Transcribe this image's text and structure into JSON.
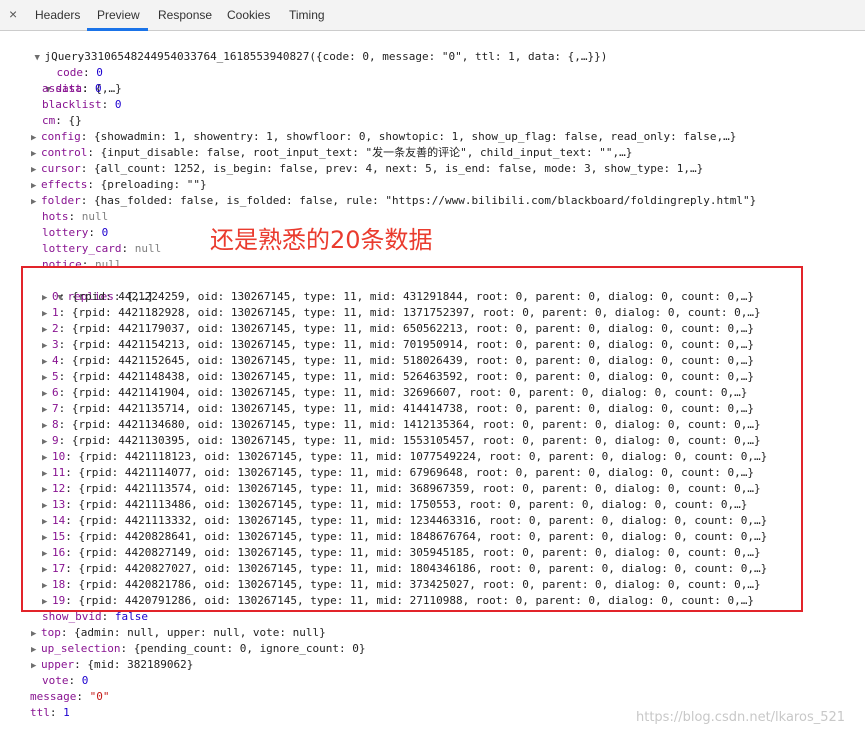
{
  "tabs": {
    "close_glyph": "×",
    "items": [
      "Headers",
      "Preview",
      "Response",
      "Cookies",
      "Timing"
    ],
    "active": "Preview"
  },
  "root_line": "jQuery33106548244954033764_1618553940827({code: 0, message: \"0\", ttl: 1, data: {,…}})",
  "top": {
    "code": {
      "key": "code",
      "value": "0"
    },
    "data": {
      "key": "data",
      "value": "{,…}"
    }
  },
  "data_fields": [
    {
      "key": "assist",
      "value": "0",
      "kind": "num",
      "expandable": false
    },
    {
      "key": "blacklist",
      "value": "0",
      "kind": "num",
      "expandable": false
    },
    {
      "key": "cm",
      "value": "{}",
      "kind": "plain",
      "expandable": false
    },
    {
      "key": "config",
      "value": "{showadmin: 1, showentry: 1, showfloor: 0, showtopic: 1, show_up_flag: false, read_only: false,…}",
      "kind": "plain",
      "expandable": true
    },
    {
      "key": "control",
      "value": "{input_disable: false, root_input_text: \"发一条友善的评论\", child_input_text: \"\",…}",
      "kind": "plain",
      "expandable": true
    },
    {
      "key": "cursor",
      "value": "{all_count: 1252, is_begin: false, prev: 4, next: 5, is_end: false, mode: 3, show_type: 1,…}",
      "kind": "plain",
      "expandable": true
    },
    {
      "key": "effects",
      "value": "{preloading: \"\"}",
      "kind": "plain",
      "expandable": true
    },
    {
      "key": "folder",
      "value": "{has_folded: false, is_folded: false, rule: \"https://www.bilibili.com/blackboard/foldingreply.html\"}",
      "kind": "plain",
      "expandable": true
    },
    {
      "key": "hots",
      "value": "null",
      "kind": "nul",
      "expandable": false
    },
    {
      "key": "lottery",
      "value": "0",
      "kind": "num",
      "expandable": false
    },
    {
      "key": "lottery_card",
      "value": "null",
      "kind": "nul",
      "expandable": false
    },
    {
      "key": "notice",
      "value": "null",
      "kind": "nul",
      "expandable": false
    }
  ],
  "replies": {
    "key": "replies",
    "value": "[,…]",
    "items": [
      {
        "i": "0",
        "text": "{rpid: 4421224259, oid: 130267145, type: 11, mid: 431291844, root: 0, parent: 0, dialog: 0, count: 0,…}"
      },
      {
        "i": "1",
        "text": "{rpid: 4421182928, oid: 130267145, type: 11, mid: 1371752397, root: 0, parent: 0, dialog: 0, count: 0,…}"
      },
      {
        "i": "2",
        "text": "{rpid: 4421179037, oid: 130267145, type: 11, mid: 650562213, root: 0, parent: 0, dialog: 0, count: 0,…}"
      },
      {
        "i": "3",
        "text": "{rpid: 4421154213, oid: 130267145, type: 11, mid: 701950914, root: 0, parent: 0, dialog: 0, count: 0,…}"
      },
      {
        "i": "4",
        "text": "{rpid: 4421152645, oid: 130267145, type: 11, mid: 518026439, root: 0, parent: 0, dialog: 0, count: 0,…}"
      },
      {
        "i": "5",
        "text": "{rpid: 4421148438, oid: 130267145, type: 11, mid: 526463592, root: 0, parent: 0, dialog: 0, count: 0,…}"
      },
      {
        "i": "6",
        "text": "{rpid: 4421141904, oid: 130267145, type: 11, mid: 32696607, root: 0, parent: 0, dialog: 0, count: 0,…}"
      },
      {
        "i": "7",
        "text": "{rpid: 4421135714, oid: 130267145, type: 11, mid: 414414738, root: 0, parent: 0, dialog: 0, count: 0,…}"
      },
      {
        "i": "8",
        "text": "{rpid: 4421134680, oid: 130267145, type: 11, mid: 1412135364, root: 0, parent: 0, dialog: 0, count: 0,…}"
      },
      {
        "i": "9",
        "text": "{rpid: 4421130395, oid: 130267145, type: 11, mid: 1553105457, root: 0, parent: 0, dialog: 0, count: 0,…}"
      },
      {
        "i": "10",
        "text": "{rpid: 4421118123, oid: 130267145, type: 11, mid: 1077549224, root: 0, parent: 0, dialog: 0, count: 0,…}"
      },
      {
        "i": "11",
        "text": "{rpid: 4421114077, oid: 130267145, type: 11, mid: 67969648, root: 0, parent: 0, dialog: 0, count: 0,…}"
      },
      {
        "i": "12",
        "text": "{rpid: 4421113574, oid: 130267145, type: 11, mid: 368967359, root: 0, parent: 0, dialog: 0, count: 0,…}"
      },
      {
        "i": "13",
        "text": "{rpid: 4421113486, oid: 130267145, type: 11, mid: 1750553, root: 0, parent: 0, dialog: 0, count: 0,…}"
      },
      {
        "i": "14",
        "text": "{rpid: 4421113332, oid: 130267145, type: 11, mid: 1234463316, root: 0, parent: 0, dialog: 0, count: 0,…}"
      },
      {
        "i": "15",
        "text": "{rpid: 4420828641, oid: 130267145, type: 11, mid: 1848676764, root: 0, parent: 0, dialog: 0, count: 0,…}"
      },
      {
        "i": "16",
        "text": "{rpid: 4420827149, oid: 130267145, type: 11, mid: 305945185, root: 0, parent: 0, dialog: 0, count: 0,…}"
      },
      {
        "i": "17",
        "text": "{rpid: 4420827027, oid: 130267145, type: 11, mid: 1804346186, root: 0, parent: 0, dialog: 0, count: 0,…}"
      },
      {
        "i": "18",
        "text": "{rpid: 4420821786, oid: 130267145, type: 11, mid: 373425027, root: 0, parent: 0, dialog: 0, count: 0,…}"
      },
      {
        "i": "19",
        "text": "{rpid: 4420791286, oid: 130267145, type: 11, mid: 27110988, root: 0, parent: 0, dialog: 0, count: 0,…}"
      }
    ]
  },
  "after_fields": [
    {
      "key": "show_bvid",
      "value": "false",
      "kind": "kw",
      "expandable": false
    },
    {
      "key": "top",
      "value": "{admin: null, upper: null, vote: null}",
      "kind": "plain",
      "expandable": true
    },
    {
      "key": "up_selection",
      "value": "{pending_count: 0, ignore_count: 0}",
      "kind": "plain",
      "expandable": true
    },
    {
      "key": "upper",
      "value": "{mid: 382189062}",
      "kind": "plain",
      "expandable": true
    },
    {
      "key": "vote",
      "value": "0",
      "kind": "num",
      "expandable": false
    }
  ],
  "tail_fields": [
    {
      "key": "message",
      "value": "\"0\"",
      "kind": "str"
    },
    {
      "key": "ttl",
      "value": "1",
      "kind": "num"
    }
  ],
  "annotation": "还是熟悉的20条数据",
  "watermark": "https://blog.csdn.net/lkaros_521",
  "colors": {
    "accent": "#1a73e8",
    "highlight": "#e2242a",
    "key": "#881391",
    "number": "#1c00cf",
    "string": "#c41a16"
  }
}
